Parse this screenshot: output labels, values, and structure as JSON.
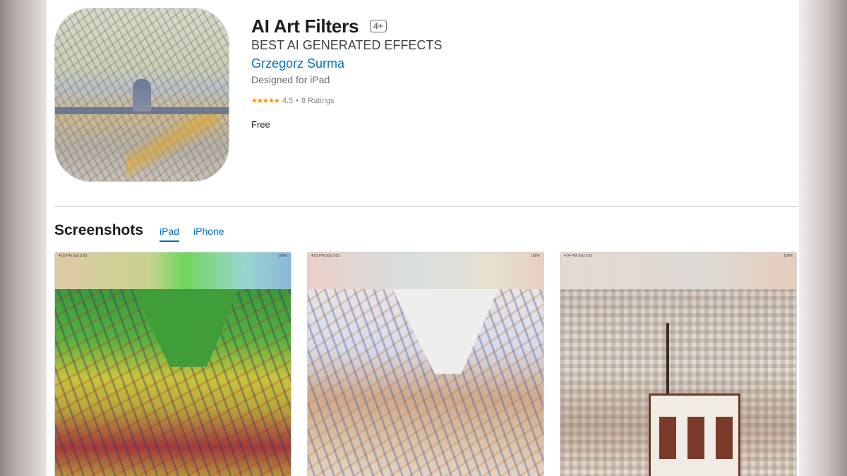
{
  "app": {
    "title": "AI Art Filters",
    "age_rating": "4+",
    "subtitle": "BEST AI GENERATED EFFECTS",
    "developer": "Grzegorz Surma",
    "designed_for": "Designed for iPad",
    "stars_glyph": "★★★★★",
    "rating_value": "4.5",
    "rating_separator": "•",
    "rating_count": "8 Ratings",
    "price": "Free"
  },
  "screenshots_section": {
    "title": "Screenshots",
    "tabs": [
      {
        "label": "iPad",
        "active": true
      },
      {
        "label": "iPhone",
        "active": false
      }
    ]
  },
  "screenshots": [
    {
      "status_left": "4:03 PM  Sob 3:03",
      "status_right": "100%"
    },
    {
      "status_left": "4:03 PM  Sob 3:03",
      "status_right": "100%"
    },
    {
      "status_left": "4:04 PM  Sob 3:03",
      "status_right": "100%"
    }
  ],
  "colors": {
    "link": "#0070c9",
    "star": "#ff9500"
  }
}
